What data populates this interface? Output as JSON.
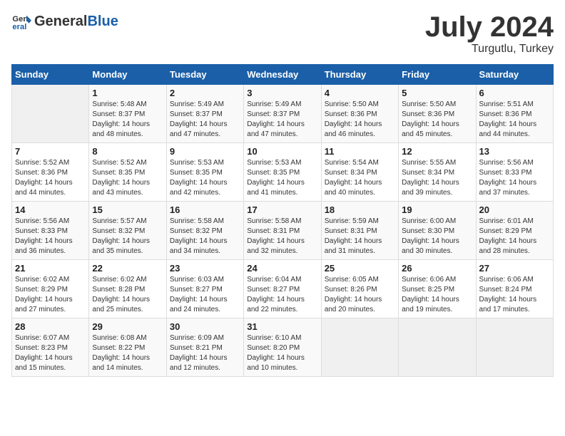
{
  "header": {
    "logo_general": "General",
    "logo_blue": "Blue",
    "month": "July 2024",
    "location": "Turgutlu, Turkey"
  },
  "columns": [
    "Sunday",
    "Monday",
    "Tuesday",
    "Wednesday",
    "Thursday",
    "Friday",
    "Saturday"
  ],
  "weeks": [
    [
      {
        "day": "",
        "info": ""
      },
      {
        "day": "1",
        "info": "Sunrise: 5:48 AM\nSunset: 8:37 PM\nDaylight: 14 hours\nand 48 minutes."
      },
      {
        "day": "2",
        "info": "Sunrise: 5:49 AM\nSunset: 8:37 PM\nDaylight: 14 hours\nand 47 minutes."
      },
      {
        "day": "3",
        "info": "Sunrise: 5:49 AM\nSunset: 8:37 PM\nDaylight: 14 hours\nand 47 minutes."
      },
      {
        "day": "4",
        "info": "Sunrise: 5:50 AM\nSunset: 8:36 PM\nDaylight: 14 hours\nand 46 minutes."
      },
      {
        "day": "5",
        "info": "Sunrise: 5:50 AM\nSunset: 8:36 PM\nDaylight: 14 hours\nand 45 minutes."
      },
      {
        "day": "6",
        "info": "Sunrise: 5:51 AM\nSunset: 8:36 PM\nDaylight: 14 hours\nand 44 minutes."
      }
    ],
    [
      {
        "day": "7",
        "info": "Sunrise: 5:52 AM\nSunset: 8:36 PM\nDaylight: 14 hours\nand 44 minutes."
      },
      {
        "day": "8",
        "info": "Sunrise: 5:52 AM\nSunset: 8:35 PM\nDaylight: 14 hours\nand 43 minutes."
      },
      {
        "day": "9",
        "info": "Sunrise: 5:53 AM\nSunset: 8:35 PM\nDaylight: 14 hours\nand 42 minutes."
      },
      {
        "day": "10",
        "info": "Sunrise: 5:53 AM\nSunset: 8:35 PM\nDaylight: 14 hours\nand 41 minutes."
      },
      {
        "day": "11",
        "info": "Sunrise: 5:54 AM\nSunset: 8:34 PM\nDaylight: 14 hours\nand 40 minutes."
      },
      {
        "day": "12",
        "info": "Sunrise: 5:55 AM\nSunset: 8:34 PM\nDaylight: 14 hours\nand 39 minutes."
      },
      {
        "day": "13",
        "info": "Sunrise: 5:56 AM\nSunset: 8:33 PM\nDaylight: 14 hours\nand 37 minutes."
      }
    ],
    [
      {
        "day": "14",
        "info": "Sunrise: 5:56 AM\nSunset: 8:33 PM\nDaylight: 14 hours\nand 36 minutes."
      },
      {
        "day": "15",
        "info": "Sunrise: 5:57 AM\nSunset: 8:32 PM\nDaylight: 14 hours\nand 35 minutes."
      },
      {
        "day": "16",
        "info": "Sunrise: 5:58 AM\nSunset: 8:32 PM\nDaylight: 14 hours\nand 34 minutes."
      },
      {
        "day": "17",
        "info": "Sunrise: 5:58 AM\nSunset: 8:31 PM\nDaylight: 14 hours\nand 32 minutes."
      },
      {
        "day": "18",
        "info": "Sunrise: 5:59 AM\nSunset: 8:31 PM\nDaylight: 14 hours\nand 31 minutes."
      },
      {
        "day": "19",
        "info": "Sunrise: 6:00 AM\nSunset: 8:30 PM\nDaylight: 14 hours\nand 30 minutes."
      },
      {
        "day": "20",
        "info": "Sunrise: 6:01 AM\nSunset: 8:29 PM\nDaylight: 14 hours\nand 28 minutes."
      }
    ],
    [
      {
        "day": "21",
        "info": "Sunrise: 6:02 AM\nSunset: 8:29 PM\nDaylight: 14 hours\nand 27 minutes."
      },
      {
        "day": "22",
        "info": "Sunrise: 6:02 AM\nSunset: 8:28 PM\nDaylight: 14 hours\nand 25 minutes."
      },
      {
        "day": "23",
        "info": "Sunrise: 6:03 AM\nSunset: 8:27 PM\nDaylight: 14 hours\nand 24 minutes."
      },
      {
        "day": "24",
        "info": "Sunrise: 6:04 AM\nSunset: 8:27 PM\nDaylight: 14 hours\nand 22 minutes."
      },
      {
        "day": "25",
        "info": "Sunrise: 6:05 AM\nSunset: 8:26 PM\nDaylight: 14 hours\nand 20 minutes."
      },
      {
        "day": "26",
        "info": "Sunrise: 6:06 AM\nSunset: 8:25 PM\nDaylight: 14 hours\nand 19 minutes."
      },
      {
        "day": "27",
        "info": "Sunrise: 6:06 AM\nSunset: 8:24 PM\nDaylight: 14 hours\nand 17 minutes."
      }
    ],
    [
      {
        "day": "28",
        "info": "Sunrise: 6:07 AM\nSunset: 8:23 PM\nDaylight: 14 hours\nand 15 minutes."
      },
      {
        "day": "29",
        "info": "Sunrise: 6:08 AM\nSunset: 8:22 PM\nDaylight: 14 hours\nand 14 minutes."
      },
      {
        "day": "30",
        "info": "Sunrise: 6:09 AM\nSunset: 8:21 PM\nDaylight: 14 hours\nand 12 minutes."
      },
      {
        "day": "31",
        "info": "Sunrise: 6:10 AM\nSunset: 8:20 PM\nDaylight: 14 hours\nand 10 minutes."
      },
      {
        "day": "",
        "info": ""
      },
      {
        "day": "",
        "info": ""
      },
      {
        "day": "",
        "info": ""
      }
    ]
  ]
}
